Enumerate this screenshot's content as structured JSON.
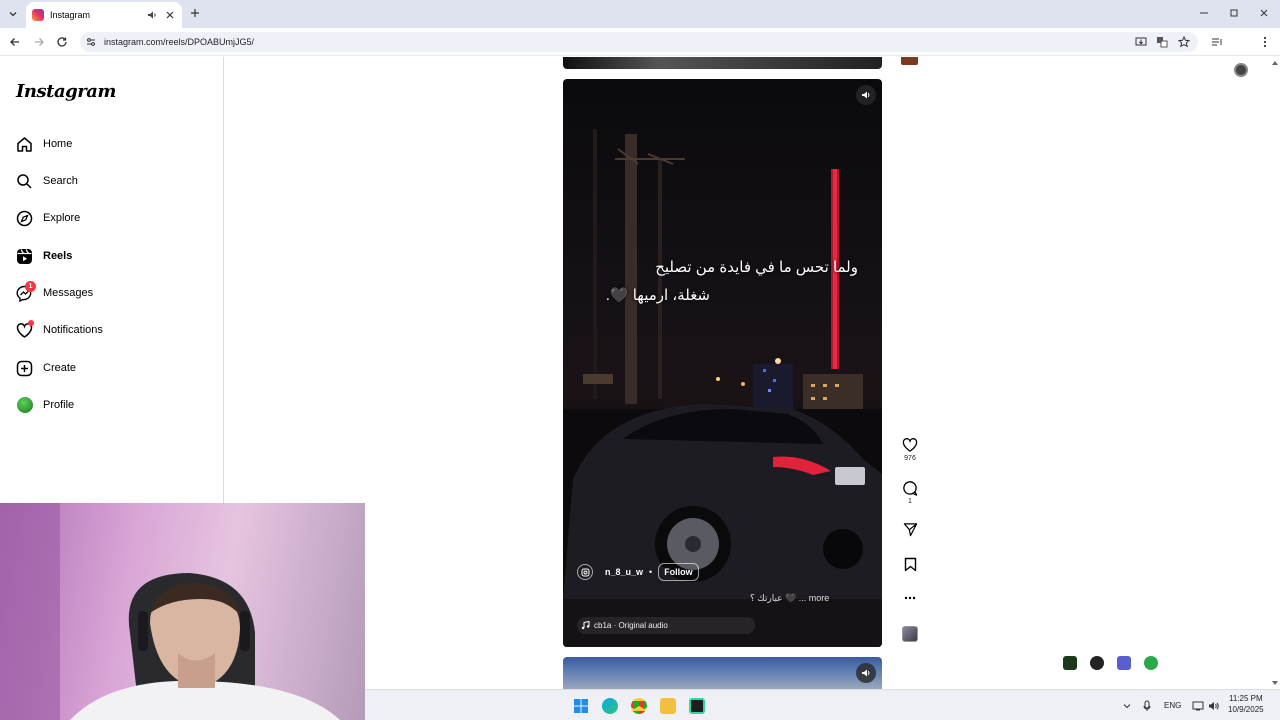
{
  "browser": {
    "tab_title": "Instagram",
    "url": "instagram.com/reels/DPOABUmjJG5/"
  },
  "sidebar": {
    "logo": "Instagram",
    "items": [
      {
        "label": "Home",
        "icon": "home-icon"
      },
      {
        "label": "Search",
        "icon": "search-icon"
      },
      {
        "label": "Explore",
        "icon": "compass-icon"
      },
      {
        "label": "Reels",
        "icon": "reels-icon",
        "active": true
      },
      {
        "label": "Messages",
        "icon": "messenger-icon",
        "badge": "1"
      },
      {
        "label": "Notifications",
        "icon": "heart-icon",
        "dot": true
      },
      {
        "label": "Create",
        "icon": "plus-square-icon"
      },
      {
        "label": "Profile",
        "icon": "profile-avatar"
      }
    ]
  },
  "reel": {
    "overlay_line1": "ولما تحس ما في فايدة من تصليح",
    "overlay_line2": "شغلة، ارميها 🖤.",
    "owner": "n_8_u_w",
    "separator": "•",
    "follow_label": "Follow",
    "caption": "عبارتك ؟ 🖤 ... more",
    "audio": "cb1a · Original audio",
    "likes": "976",
    "comments": "1"
  },
  "taskbar": {
    "language": "ENG",
    "time": "11:25 PM",
    "date": "10/9/2025"
  },
  "colors": {
    "accent_red": "#ff3040",
    "reel_bg": "#0a0a0c",
    "chrome_bg": "#dfe3ef"
  }
}
